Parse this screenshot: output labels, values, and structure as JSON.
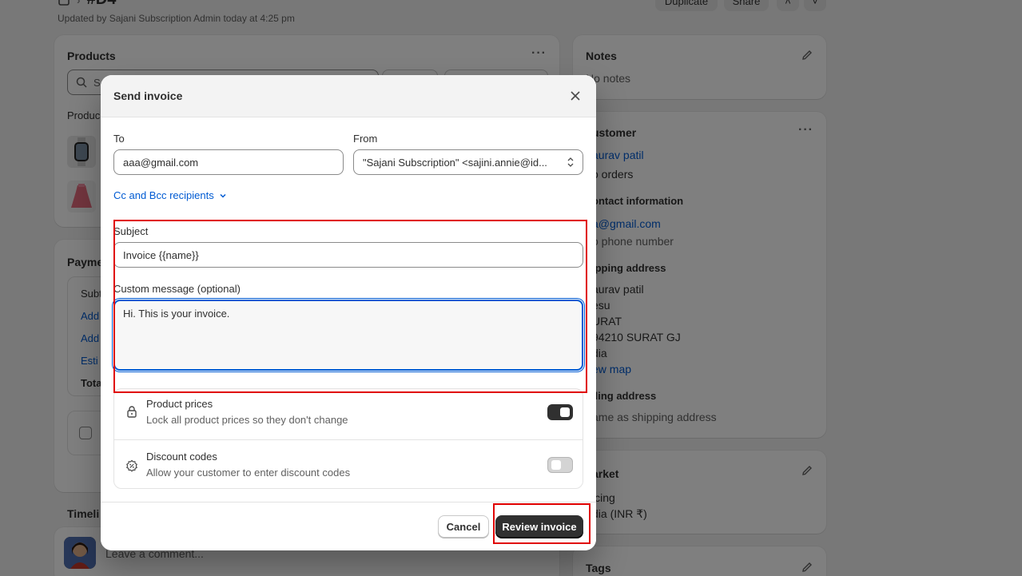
{
  "page": {
    "order_number": "#D4",
    "updated_text": "Updated by Sajani Subscription Admin today at 4:25 pm",
    "header_buttons": [
      "Duplicate",
      "Share"
    ]
  },
  "products_card": {
    "title": "Products",
    "search_placeholder": "S",
    "section_label": "Produc"
  },
  "payment_card": {
    "title": "Payme",
    "rows": [
      "Subt",
      "Add",
      "Add",
      "Esti",
      "Tota"
    ]
  },
  "timeline": {
    "title": "Timeli",
    "comment_placeholder": "Leave a comment..."
  },
  "notes_card": {
    "title": "Notes",
    "text": "No notes"
  },
  "customer_card": {
    "title": "ustomer",
    "name": "aurav patil",
    "orders": "o orders",
    "contact_heading": "ontact information",
    "email": "a@gmail.com",
    "phone": "o phone number",
    "shipping_heading": "ipping address",
    "address_lines": [
      "aurav patil",
      "esu",
      "URAT",
      "94210 SURAT GJ",
      "dia"
    ],
    "view_map": "ew map",
    "billing_heading": "lling address",
    "billing_text": "ame as shipping address"
  },
  "market_card": {
    "title": "arket",
    "pricing_label": "icing",
    "pricing_value": "dia (INR ₹)"
  },
  "tags_card": {
    "title": "Tags"
  },
  "modal": {
    "title": "Send invoice",
    "to_label": "To",
    "to_value": "aaa@gmail.com",
    "from_label": "From",
    "from_value": "\"Sajani Subscription\" <sajini.annie@id...",
    "cc_bcc_label": "Cc and Bcc recipients",
    "subject_label": "Subject",
    "subject_value": "Invoice {{name}}",
    "message_label": "Custom message (optional)",
    "message_value": "Hi. This is your invoice.",
    "options": [
      {
        "title": "Product prices",
        "description": "Lock all product prices so they don't change",
        "enabled": true,
        "icon": "lock-icon"
      },
      {
        "title": "Discount codes",
        "description": "Allow your customer to enter discount codes",
        "enabled": false,
        "icon": "discount-icon"
      }
    ],
    "cancel_label": "Cancel",
    "review_label": "Review invoice"
  },
  "colors": {
    "accent": "#005bd3",
    "highlight_box": "#e00000",
    "primary_button": "#303030"
  }
}
